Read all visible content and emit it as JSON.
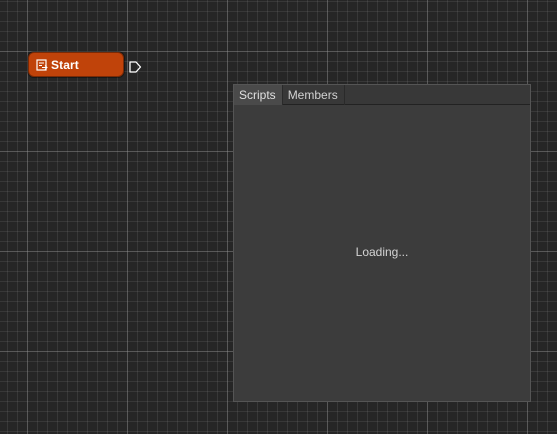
{
  "node": {
    "label": "Start",
    "icon": "event-icon",
    "color": "#c0430a"
  },
  "panel": {
    "tabs": [
      {
        "label": "Scripts",
        "active": true
      },
      {
        "label": "Members",
        "active": false
      }
    ],
    "status": "Loading..."
  },
  "colors": {
    "canvas_background": "#262626",
    "panel_background": "#3c3c3c"
  }
}
